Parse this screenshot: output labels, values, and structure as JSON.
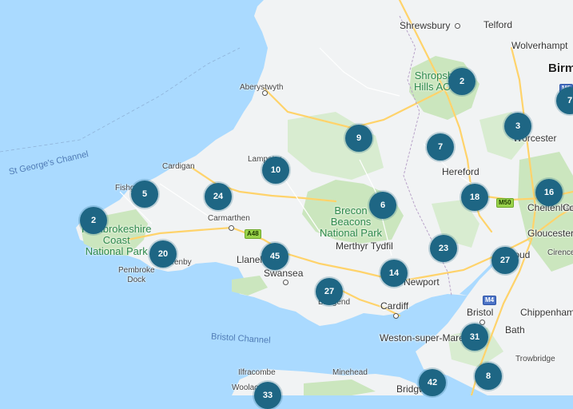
{
  "colors": {
    "sea": "#aadaff",
    "land": "#f1f3f4",
    "park": "#cbe6be",
    "cluster": "#1e6684",
    "road_major": "#ffd36b"
  },
  "places": [
    {
      "id": "shrewsbury",
      "text": "Shrewsbury"
    },
    {
      "id": "telford",
      "text": "Telford"
    },
    {
      "id": "wolverhampton",
      "text": "Wolverhampt"
    },
    {
      "id": "birmingham",
      "text": "Birm"
    },
    {
      "id": "aberystwyth",
      "text": "Aberystwyth"
    },
    {
      "id": "worcester",
      "text": "Worcester"
    },
    {
      "id": "hereford",
      "text": "Hereford"
    },
    {
      "id": "cardigan",
      "text": "Cardigan"
    },
    {
      "id": "lampeter",
      "text": "Lampeter"
    },
    {
      "id": "fishguard",
      "text": "Fishguard"
    },
    {
      "id": "carmarthen",
      "text": "Carmarthen"
    },
    {
      "id": "cheltenham",
      "text": "Cheltenham"
    },
    {
      "id": "gloucester",
      "text": "Gloucester"
    },
    {
      "id": "merthyr",
      "text": "Merthyr Tydfil"
    },
    {
      "id": "llanelli",
      "text": "Llanelli"
    },
    {
      "id": "swansea",
      "text": "Swansea"
    },
    {
      "id": "pembroke",
      "text": "Pembroke\nDock"
    },
    {
      "id": "tenby",
      "text": "Tenby"
    },
    {
      "id": "newport",
      "text": "Newport"
    },
    {
      "id": "stroud",
      "text": "Stroud"
    },
    {
      "id": "cirencester",
      "text": "Cirence"
    },
    {
      "id": "cardiff",
      "text": "Cardiff"
    },
    {
      "id": "bridgend",
      "text": "Bridgend"
    },
    {
      "id": "bristol",
      "text": "Bristol"
    },
    {
      "id": "chippenham",
      "text": "Chippenham"
    },
    {
      "id": "bath",
      "text": "Bath"
    },
    {
      "id": "trowbridge",
      "text": "Trowbridge"
    },
    {
      "id": "weston",
      "text": "Weston-super-Mare"
    },
    {
      "id": "ilfracombe",
      "text": "Ilfracombe"
    },
    {
      "id": "minehead",
      "text": "Minehead"
    },
    {
      "id": "woolacombe",
      "text": "Woolacombe"
    },
    {
      "id": "bridgwater",
      "text": "Bridgwa"
    },
    {
      "id": "cotswolds",
      "text": "Co"
    }
  ],
  "parks": [
    {
      "id": "shropshire",
      "text": "Shropshire\nHills AONB"
    },
    {
      "id": "brecon",
      "text": "Brecon\nBeacons\nNational Park"
    },
    {
      "id": "pembrokeshire",
      "text": "Pembrokeshire\nCoast\nNational Park"
    }
  ],
  "seas": [
    {
      "id": "st-georges",
      "text": "St George's Channel"
    },
    {
      "id": "bristol-channel",
      "text": "Bristol Channel"
    }
  ],
  "roads": [
    {
      "id": "a48",
      "text": "A48"
    },
    {
      "id": "m50",
      "text": "M50"
    },
    {
      "id": "m4",
      "text": "M4"
    },
    {
      "id": "m5",
      "text": "M5"
    }
  ],
  "clusters": [
    {
      "id": "c1",
      "count": "2"
    },
    {
      "id": "c2",
      "count": "7"
    },
    {
      "id": "c3",
      "count": "3"
    },
    {
      "id": "c4",
      "count": "9"
    },
    {
      "id": "c5",
      "count": "7"
    },
    {
      "id": "c6",
      "count": "10"
    },
    {
      "id": "c7",
      "count": "5"
    },
    {
      "id": "c8",
      "count": "24"
    },
    {
      "id": "c9",
      "count": "18"
    },
    {
      "id": "c10",
      "count": "16"
    },
    {
      "id": "c11",
      "count": "6"
    },
    {
      "id": "c12",
      "count": "2"
    },
    {
      "id": "c13",
      "count": "20"
    },
    {
      "id": "c14",
      "count": "45"
    },
    {
      "id": "c15",
      "count": "23"
    },
    {
      "id": "c16",
      "count": "27"
    },
    {
      "id": "c17",
      "count": "14"
    },
    {
      "id": "c18",
      "count": "27"
    },
    {
      "id": "c19",
      "count": "31"
    },
    {
      "id": "c20",
      "count": "8"
    },
    {
      "id": "c21",
      "count": "42"
    },
    {
      "id": "c22",
      "count": "33"
    }
  ]
}
